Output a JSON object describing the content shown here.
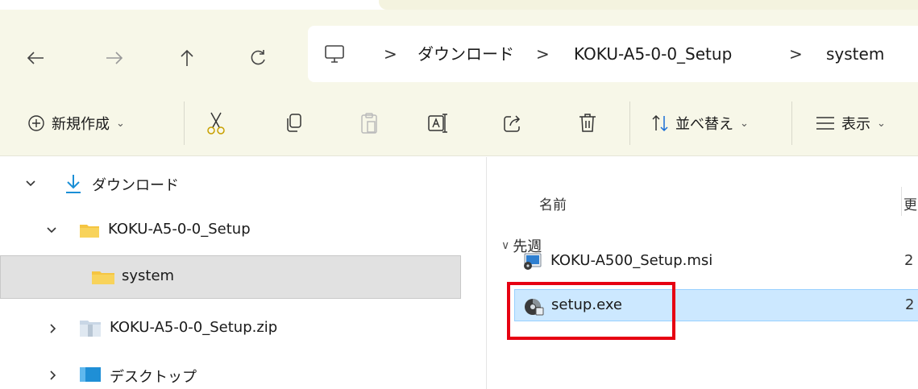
{
  "nav": {
    "back_icon": "arrow-left-icon",
    "forward_icon": "arrow-right-icon",
    "up_icon": "arrow-up-icon",
    "refresh_icon": "refresh-icon"
  },
  "address": {
    "root_icon": "computer-icon",
    "separator": ">",
    "crumbs": [
      "ダウンロード",
      "KOKU-A5-0-0_Setup",
      "system"
    ]
  },
  "commands": {
    "new": "新規作成",
    "sort": "並べ替え",
    "view": "表示",
    "caret": "⌄"
  },
  "tree": {
    "items": [
      {
        "label": "ダウンロード",
        "icon": "download-icon",
        "expanded": true
      },
      {
        "label": "KOKU-A5-0-0_Setup",
        "icon": "folder-icon",
        "expanded": true
      },
      {
        "label": "system",
        "icon": "folder-icon",
        "selected": true
      },
      {
        "label": "KOKU-A5-0-0_Setup.zip",
        "icon": "zip-folder-icon",
        "expanded": false
      },
      {
        "label": "デスクトップ",
        "icon": "desktop-icon",
        "expanded": false
      }
    ]
  },
  "content": {
    "column_name": "名前",
    "column_next_partial": "更",
    "group": "先週",
    "files": [
      {
        "name": "KOKU-A500_Setup.msi",
        "icon": "msi-installer-icon",
        "trunc": "2"
      },
      {
        "name": "setup.exe",
        "icon": "setup-exe-icon",
        "trunc": "2",
        "selected": true
      }
    ]
  },
  "colors": {
    "chrome": "#f7f7e8",
    "selected_row": "#cce8ff",
    "highlight_box": "#e60012",
    "folder": "#f5c542"
  }
}
